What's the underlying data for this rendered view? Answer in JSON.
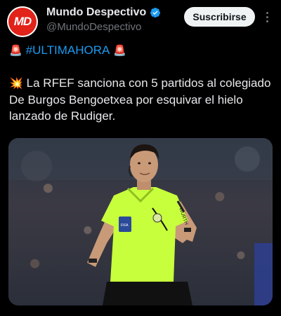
{
  "account": {
    "avatar_text": "MD",
    "display_name": "Mundo Despectivo",
    "handle": "@MundoDespectivo",
    "verified": true
  },
  "actions": {
    "subscribe_label": "Suscribirse",
    "more_icon": "more-vertical-icon"
  },
  "tweet": {
    "siren_emoji": "🚨",
    "hashtag": "#ULTIMAHORA",
    "boom_emoji": "💥",
    "text": "La RFEF sanciona con 5 partidos al colegiado De Burgos Bengoetxea por esquivar el hielo lanzado de Rudiger."
  },
  "media": {
    "badge_text": "FIFA",
    "sleeve_text": "WURTH"
  },
  "colors": {
    "background": "#000000",
    "accent": "#1d9bf0",
    "verified": "#1d9bf0",
    "jersey": "#c8ff3c",
    "avatar_red": "#e2231a"
  }
}
